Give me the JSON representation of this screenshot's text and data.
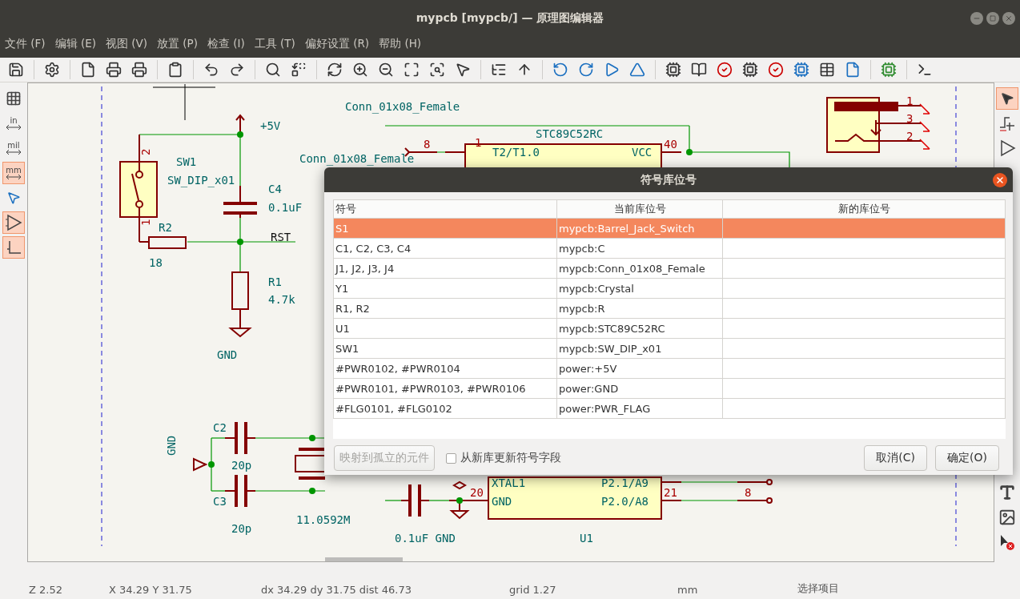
{
  "window": {
    "title": "mypcb [mypcb/] — 原理图编辑器"
  },
  "menu": [
    "文件 (F)",
    "编辑 (E)",
    "视图 (V)",
    "放置 (P)",
    "检查 (I)",
    "工具 (T)",
    "偏好设置 (R)",
    "帮助 (H)"
  ],
  "left_tools": [
    {
      "kind": "grid",
      "selected": false
    },
    {
      "kind": "unit",
      "label": "in",
      "selected": false
    },
    {
      "kind": "unit",
      "label": "mil",
      "selected": false
    },
    {
      "kind": "unit",
      "label": "mm",
      "selected": true
    },
    {
      "kind": "cursor",
      "selected": false
    },
    {
      "kind": "pins",
      "selected": true
    },
    {
      "kind": "corner",
      "selected": true
    }
  ],
  "right_tools": [
    {
      "kind": "select",
      "selected": true
    },
    {
      "kind": "wire",
      "selected": false
    },
    {
      "kind": "symbol",
      "selected": false
    },
    {
      "kind": "text",
      "selected": false
    },
    {
      "kind": "image",
      "selected": false
    },
    {
      "kind": "delete",
      "selected": false
    }
  ],
  "schematic": {
    "labels": [
      "+5V",
      "SW1",
      "SW_DIP_x01",
      "C4",
      "0.1uF",
      "R2",
      "RST",
      "18",
      "R1",
      "4.7k",
      "GND",
      "Conn_01x08_Female",
      "STC89C52RC",
      "Conn_01x08_Female",
      "T2/T1.0",
      "VCC",
      "C2",
      "C3",
      "20p",
      "20p",
      "GND",
      "11.0592M",
      "0.1uF GND",
      "XTAL1",
      "P2.1/A9",
      "GND",
      "P2.0/A8",
      "U1"
    ],
    "pin_numbers": [
      "2",
      "1",
      "8",
      "1",
      "40",
      "20",
      "21",
      "8",
      "1",
      "3",
      "2"
    ]
  },
  "dialog": {
    "title": "符号库位号",
    "columns": [
      "符号",
      "当前库位号",
      "新的库位号"
    ],
    "rows": [
      {
        "symbol": "S1",
        "current": "mypcb:Barrel_Jack_Switch",
        "selected": true
      },
      {
        "symbol": "C1, C2, C3, C4",
        "current": "mypcb:C",
        "selected": false
      },
      {
        "symbol": "J1, J2, J3, J4",
        "current": "mypcb:Conn_01x08_Female",
        "selected": false
      },
      {
        "symbol": "Y1",
        "current": "mypcb:Crystal",
        "selected": false
      },
      {
        "symbol": "R1, R2",
        "current": "mypcb:R",
        "selected": false
      },
      {
        "symbol": "U1",
        "current": "mypcb:STC89C52RC",
        "selected": false
      },
      {
        "symbol": "SW1",
        "current": "mypcb:SW_DIP_x01",
        "selected": false
      },
      {
        "symbol": "#PWR0102, #PWR0104",
        "current": "power:+5V",
        "selected": false
      },
      {
        "symbol": "#PWR0101, #PWR0103, #PWR0106",
        "current": "power:GND",
        "selected": false
      },
      {
        "symbol": "#FLG0101, #FLG0102",
        "current": "power:PWR_FLAG",
        "selected": false
      }
    ],
    "map_button": {
      "label": "映射到孤立的元件",
      "disabled": true
    },
    "update_checkbox": {
      "label": "从新库更新符号字段",
      "checked": false
    },
    "buttons": [
      "取消(C)",
      "确定(O)"
    ]
  },
  "status_bar": [
    "Z 2.52",
    "X 34.29  Y 31.75",
    "dx 34.29  dy 31.75  dist 46.73",
    "grid 1.27",
    "mm",
    "选择项目"
  ]
}
